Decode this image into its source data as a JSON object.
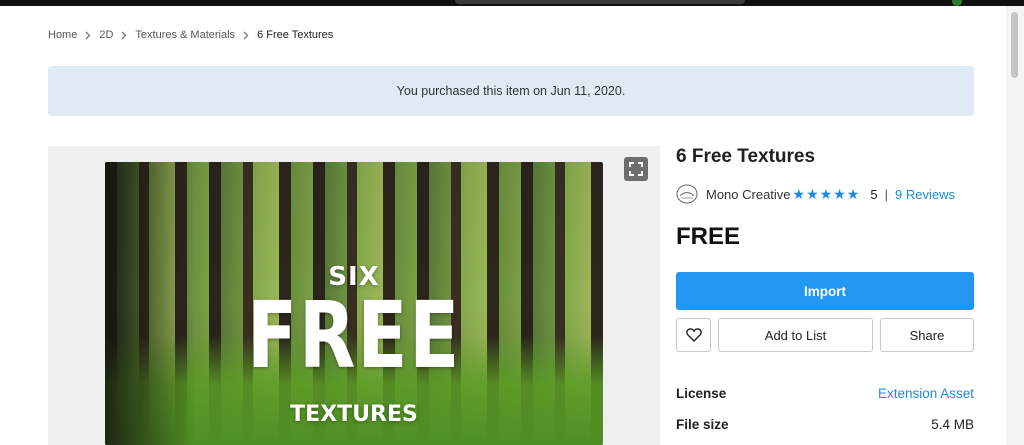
{
  "breadcrumb": {
    "items": [
      "Home",
      "2D",
      "Textures & Materials",
      "6 Free Textures"
    ]
  },
  "notice": {
    "text": "You purchased this item on Jun 11, 2020."
  },
  "media": {
    "hero": {
      "line1": "SIX",
      "line2": "FREE",
      "line3": "TEXTURES"
    },
    "expand_icon": "fullscreen-icon"
  },
  "product": {
    "title": "6 Free Textures",
    "publisher": "Mono Creative",
    "rating_stars": 5,
    "rating_value": "5",
    "rating_separator": "|",
    "reviews_label": "9 Reviews",
    "price": "FREE"
  },
  "actions": {
    "import_label": "Import",
    "favorite_icon": "heart-icon",
    "add_to_list_label": "Add to List",
    "share_label": "Share"
  },
  "details": {
    "license_label": "License",
    "license_value": "Extension Asset",
    "file_size_label": "File size",
    "file_size_value": "5.4 MB"
  },
  "colors": {
    "accent": "#2196f3",
    "link": "#1e88e5",
    "notice_bg": "#dfeaf5",
    "star": "#1e88e5"
  }
}
